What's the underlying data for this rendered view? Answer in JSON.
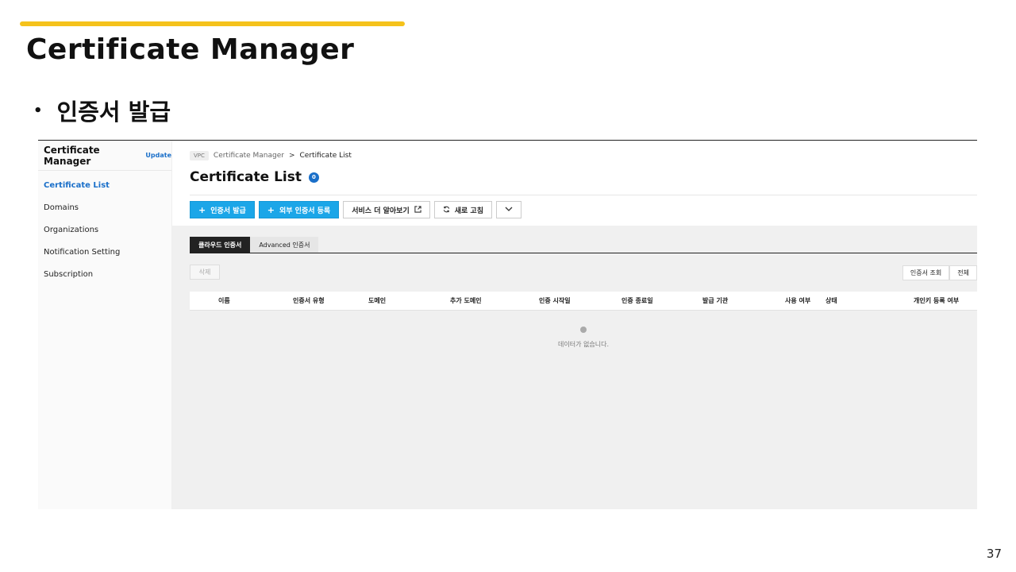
{
  "slide": {
    "title": "Certificate Manager",
    "bullet_symbol": "•",
    "bullet": "인증서 발급",
    "page_number": "37"
  },
  "console": {
    "sidebar": {
      "title": "Certificate Manager",
      "update_label": "Update",
      "items": [
        {
          "label": "Certificate List",
          "active": true
        },
        {
          "label": "Domains",
          "active": false
        },
        {
          "label": "Organizations",
          "active": false
        },
        {
          "label": "Notification Setting",
          "active": false
        },
        {
          "label": "Subscription",
          "active": false
        }
      ]
    },
    "breadcrumb": {
      "badge": "VPC",
      "items": [
        "Certificate Manager",
        "Certificate List"
      ],
      "separator": ">"
    },
    "page_title": "Certificate List",
    "count": "0",
    "toolbar": {
      "issue_label": "인증서 발급",
      "register_label": "외부 인증서 등록",
      "learn_more_label": "서비스 더 알아보기",
      "refresh_label": "새로 고침"
    },
    "tabs": [
      {
        "label": "클라우드 인증서",
        "active": true
      },
      {
        "label": "Advanced 인증서",
        "active": false
      }
    ],
    "delete_label": "삭제",
    "filters": [
      "인증서 조회",
      "전체"
    ],
    "columns": [
      "이름",
      "인증서 유형",
      "도메인",
      "추가 도메인",
      "인증 시작일",
      "인증 종료일",
      "발급 기관",
      "사용 여부",
      "상태",
      "개인키 등록 여부"
    ],
    "empty_message": "데이터가 없습니다."
  },
  "colors": {
    "accent_bar": "#f5c21b",
    "primary_button": "#1ba6e8",
    "active_link": "#1a6fc9",
    "active_tab": "#222222"
  }
}
